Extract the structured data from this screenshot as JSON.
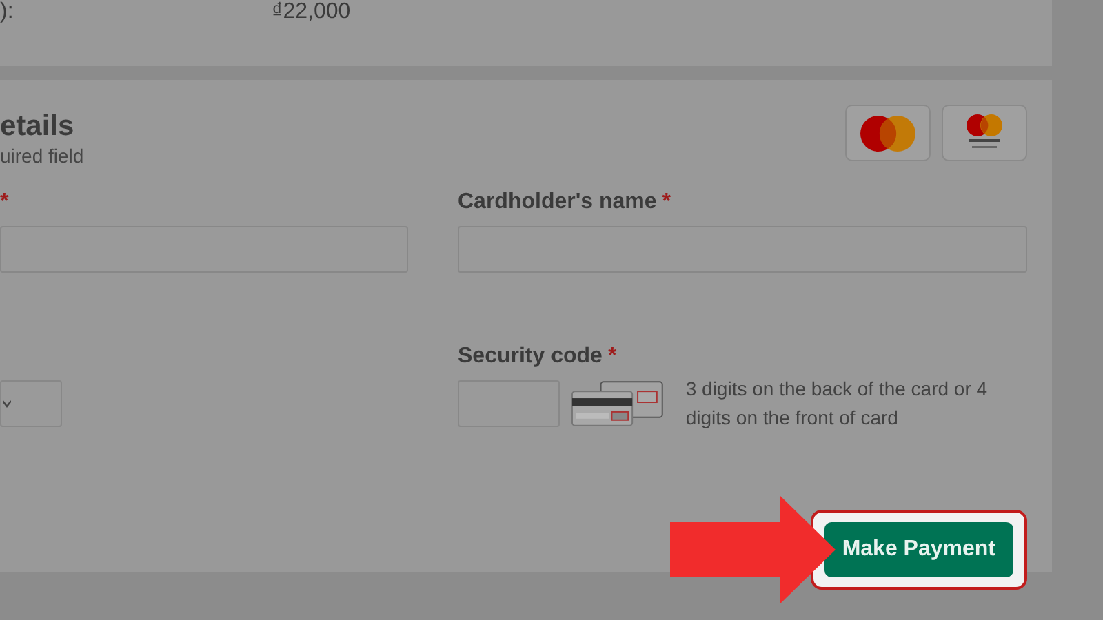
{
  "summary": {
    "label": "):",
    "value": "₫22,000"
  },
  "payment": {
    "title": "etails",
    "subtitle": "uired field",
    "card_logos": [
      {
        "kind": "mastercard"
      },
      {
        "kind": "securecode"
      }
    ],
    "fields": [
      {
        "kind": "text",
        "required_mark": "*"
      },
      {
        "kind": "text",
        "label": "Cardholder's name",
        "required_mark": "*"
      },
      {
        "kind": "select"
      },
      {
        "kind": "cvv",
        "label": "Security code",
        "required_mark": "*",
        "hint": "3 digits on the back of the card or 4 digits on the front of card"
      }
    ],
    "button": {
      "label": "Make Payment",
      "highlighted": true
    }
  },
  "callout": {
    "kind": "arrow"
  }
}
